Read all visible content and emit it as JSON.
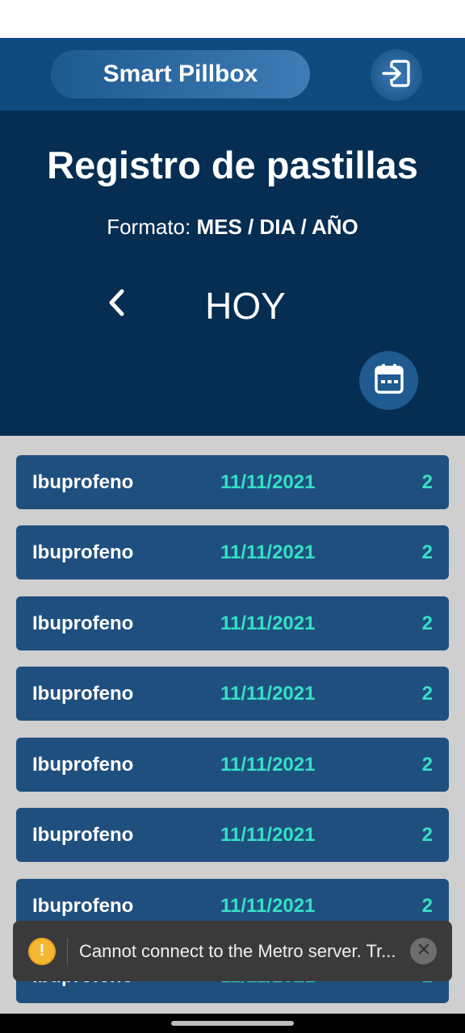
{
  "header": {
    "brand": "Smart Pillbox",
    "logout_icon": "logout-icon"
  },
  "hero": {
    "title": "Registro de pastillas",
    "format_label": "Formato:",
    "format_value": "MES / DIA / AÑO",
    "day_label": "HOY",
    "prev_icon": "chevron-left-icon",
    "calendar_icon": "calendar-icon"
  },
  "records": [
    {
      "name": "Ibuprofeno",
      "date": "11/11/2021",
      "count": "2"
    },
    {
      "name": "Ibuprofeno",
      "date": "11/11/2021",
      "count": "2"
    },
    {
      "name": "Ibuprofeno",
      "date": "11/11/2021",
      "count": "2"
    },
    {
      "name": "Ibuprofeno",
      "date": "11/11/2021",
      "count": "2"
    },
    {
      "name": "Ibuprofeno",
      "date": "11/11/2021",
      "count": "2"
    },
    {
      "name": "Ibuprofeno",
      "date": "11/11/2021",
      "count": "2"
    },
    {
      "name": "Ibuprofeno",
      "date": "11/11/2021",
      "count": "2"
    },
    {
      "name": "Ibuprofeno",
      "date": "11/11/2021",
      "count": "2"
    }
  ],
  "toast": {
    "icon_glyph": "!",
    "message": "Cannot connect to the Metro server.  Tr...",
    "close_icon": "close-icon"
  },
  "colors": {
    "header": "#0f4a7e",
    "hero": "#062d52",
    "row": "#1f4f7f",
    "accent_teal": "#35e0c4",
    "list_background": "#cfcfcf",
    "warning": "#f5b731"
  }
}
